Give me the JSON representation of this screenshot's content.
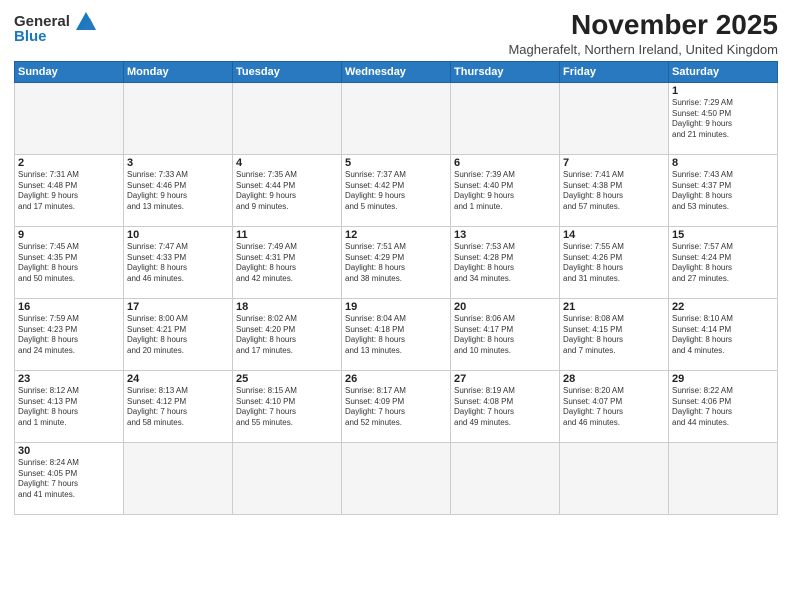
{
  "header": {
    "logo_line1": "General",
    "logo_line2": "Blue",
    "title": "November 2025",
    "subtitle": "Magherafelt, Northern Ireland, United Kingdom"
  },
  "weekdays": [
    "Sunday",
    "Monday",
    "Tuesday",
    "Wednesday",
    "Thursday",
    "Friday",
    "Saturday"
  ],
  "weeks": [
    [
      {
        "day": "",
        "info": ""
      },
      {
        "day": "",
        "info": ""
      },
      {
        "day": "",
        "info": ""
      },
      {
        "day": "",
        "info": ""
      },
      {
        "day": "",
        "info": ""
      },
      {
        "day": "",
        "info": ""
      },
      {
        "day": "1",
        "info": "Sunrise: 7:29 AM\nSunset: 4:50 PM\nDaylight: 9 hours\nand 21 minutes."
      }
    ],
    [
      {
        "day": "2",
        "info": "Sunrise: 7:31 AM\nSunset: 4:48 PM\nDaylight: 9 hours\nand 17 minutes."
      },
      {
        "day": "3",
        "info": "Sunrise: 7:33 AM\nSunset: 4:46 PM\nDaylight: 9 hours\nand 13 minutes."
      },
      {
        "day": "4",
        "info": "Sunrise: 7:35 AM\nSunset: 4:44 PM\nDaylight: 9 hours\nand 9 minutes."
      },
      {
        "day": "5",
        "info": "Sunrise: 7:37 AM\nSunset: 4:42 PM\nDaylight: 9 hours\nand 5 minutes."
      },
      {
        "day": "6",
        "info": "Sunrise: 7:39 AM\nSunset: 4:40 PM\nDaylight: 9 hours\nand 1 minute."
      },
      {
        "day": "7",
        "info": "Sunrise: 7:41 AM\nSunset: 4:38 PM\nDaylight: 8 hours\nand 57 minutes."
      },
      {
        "day": "8",
        "info": "Sunrise: 7:43 AM\nSunset: 4:37 PM\nDaylight: 8 hours\nand 53 minutes."
      }
    ],
    [
      {
        "day": "9",
        "info": "Sunrise: 7:45 AM\nSunset: 4:35 PM\nDaylight: 8 hours\nand 50 minutes."
      },
      {
        "day": "10",
        "info": "Sunrise: 7:47 AM\nSunset: 4:33 PM\nDaylight: 8 hours\nand 46 minutes."
      },
      {
        "day": "11",
        "info": "Sunrise: 7:49 AM\nSunset: 4:31 PM\nDaylight: 8 hours\nand 42 minutes."
      },
      {
        "day": "12",
        "info": "Sunrise: 7:51 AM\nSunset: 4:29 PM\nDaylight: 8 hours\nand 38 minutes."
      },
      {
        "day": "13",
        "info": "Sunrise: 7:53 AM\nSunset: 4:28 PM\nDaylight: 8 hours\nand 34 minutes."
      },
      {
        "day": "14",
        "info": "Sunrise: 7:55 AM\nSunset: 4:26 PM\nDaylight: 8 hours\nand 31 minutes."
      },
      {
        "day": "15",
        "info": "Sunrise: 7:57 AM\nSunset: 4:24 PM\nDaylight: 8 hours\nand 27 minutes."
      }
    ],
    [
      {
        "day": "16",
        "info": "Sunrise: 7:59 AM\nSunset: 4:23 PM\nDaylight: 8 hours\nand 24 minutes."
      },
      {
        "day": "17",
        "info": "Sunrise: 8:00 AM\nSunset: 4:21 PM\nDaylight: 8 hours\nand 20 minutes."
      },
      {
        "day": "18",
        "info": "Sunrise: 8:02 AM\nSunset: 4:20 PM\nDaylight: 8 hours\nand 17 minutes."
      },
      {
        "day": "19",
        "info": "Sunrise: 8:04 AM\nSunset: 4:18 PM\nDaylight: 8 hours\nand 13 minutes."
      },
      {
        "day": "20",
        "info": "Sunrise: 8:06 AM\nSunset: 4:17 PM\nDaylight: 8 hours\nand 10 minutes."
      },
      {
        "day": "21",
        "info": "Sunrise: 8:08 AM\nSunset: 4:15 PM\nDaylight: 8 hours\nand 7 minutes."
      },
      {
        "day": "22",
        "info": "Sunrise: 8:10 AM\nSunset: 4:14 PM\nDaylight: 8 hours\nand 4 minutes."
      }
    ],
    [
      {
        "day": "23",
        "info": "Sunrise: 8:12 AM\nSunset: 4:13 PM\nDaylight: 8 hours\nand 1 minute."
      },
      {
        "day": "24",
        "info": "Sunrise: 8:13 AM\nSunset: 4:12 PM\nDaylight: 7 hours\nand 58 minutes."
      },
      {
        "day": "25",
        "info": "Sunrise: 8:15 AM\nSunset: 4:10 PM\nDaylight: 7 hours\nand 55 minutes."
      },
      {
        "day": "26",
        "info": "Sunrise: 8:17 AM\nSunset: 4:09 PM\nDaylight: 7 hours\nand 52 minutes."
      },
      {
        "day": "27",
        "info": "Sunrise: 8:19 AM\nSunset: 4:08 PM\nDaylight: 7 hours\nand 49 minutes."
      },
      {
        "day": "28",
        "info": "Sunrise: 8:20 AM\nSunset: 4:07 PM\nDaylight: 7 hours\nand 46 minutes."
      },
      {
        "day": "29",
        "info": "Sunrise: 8:22 AM\nSunset: 4:06 PM\nDaylight: 7 hours\nand 44 minutes."
      }
    ],
    [
      {
        "day": "30",
        "info": "Sunrise: 8:24 AM\nSunset: 4:05 PM\nDaylight: 7 hours\nand 41 minutes."
      },
      {
        "day": "",
        "info": ""
      },
      {
        "day": "",
        "info": ""
      },
      {
        "day": "",
        "info": ""
      },
      {
        "day": "",
        "info": ""
      },
      {
        "day": "",
        "info": ""
      },
      {
        "day": "",
        "info": ""
      }
    ]
  ]
}
